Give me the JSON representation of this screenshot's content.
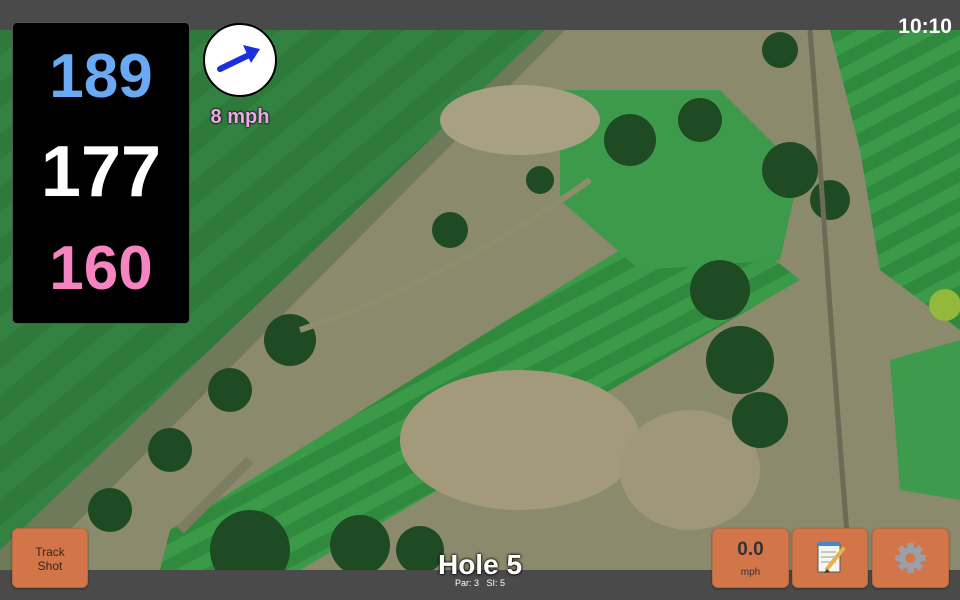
{
  "status": {
    "time": "10:10"
  },
  "distances": {
    "back": "189",
    "center": "177",
    "front": "160"
  },
  "wind": {
    "speed": "8 mph",
    "direction": "arrow pointing up-right"
  },
  "buttons": {
    "track_shot_line1": "Track",
    "track_shot_line2": "Shot",
    "speed_value": "0.0",
    "speed_unit": "mph",
    "notes_icon": "notepad-icon",
    "settings_icon": "gear-icon"
  },
  "hole": {
    "title": "Hole 5",
    "par_label": "Par: 3",
    "si_label": "SI: 5"
  },
  "colors": {
    "back_distance": "#6aaaf4",
    "center_distance": "#ffffff",
    "front_distance": "#f584c0",
    "button": "#d2764a",
    "wind_text": "#f0a8e8",
    "wind_arrow": "#1830e0"
  }
}
